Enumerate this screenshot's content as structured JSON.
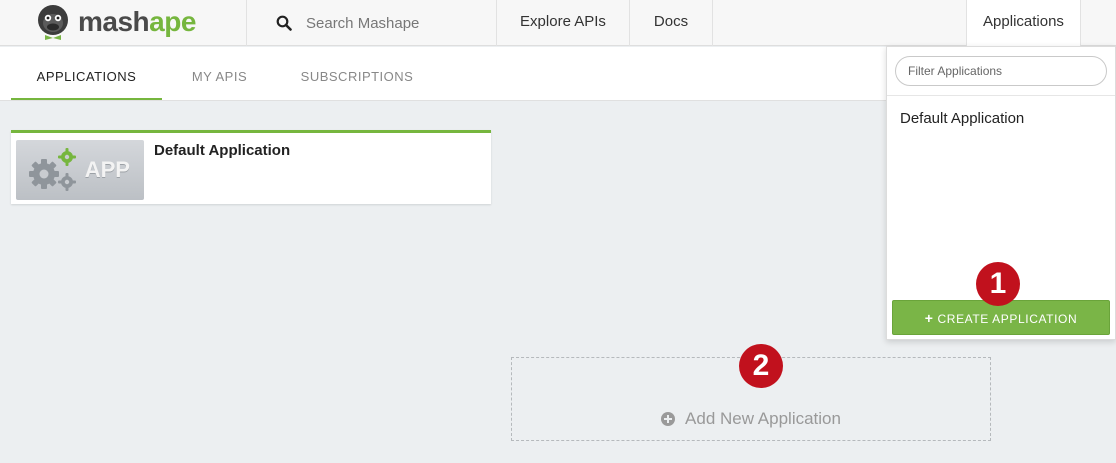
{
  "brand": {
    "part1": "mash",
    "part2": "ape"
  },
  "nav": {
    "search_placeholder": "Search Mashape",
    "explore": "Explore APIs",
    "docs": "Docs",
    "applications": "Applications"
  },
  "tabs": [
    {
      "label": "APPLICATIONS",
      "active": true
    },
    {
      "label": "MY APIS",
      "active": false
    },
    {
      "label": "SUBSCRIPTIONS",
      "active": false
    }
  ],
  "app_card": {
    "thumb_label": "APP",
    "name": "Default Application"
  },
  "add_new": {
    "label": "Add New Application"
  },
  "dropdown": {
    "filter_placeholder": "Filter Applications",
    "items": [
      "Default Application"
    ],
    "create_label": "CREATE APPLICATION",
    "create_plus": "+"
  },
  "callouts": [
    "1",
    "2"
  ],
  "colors": {
    "accent_green": "#76b63e",
    "button_green": "#7ab547",
    "callout_red": "#c1111d",
    "background": "#eceff1"
  }
}
